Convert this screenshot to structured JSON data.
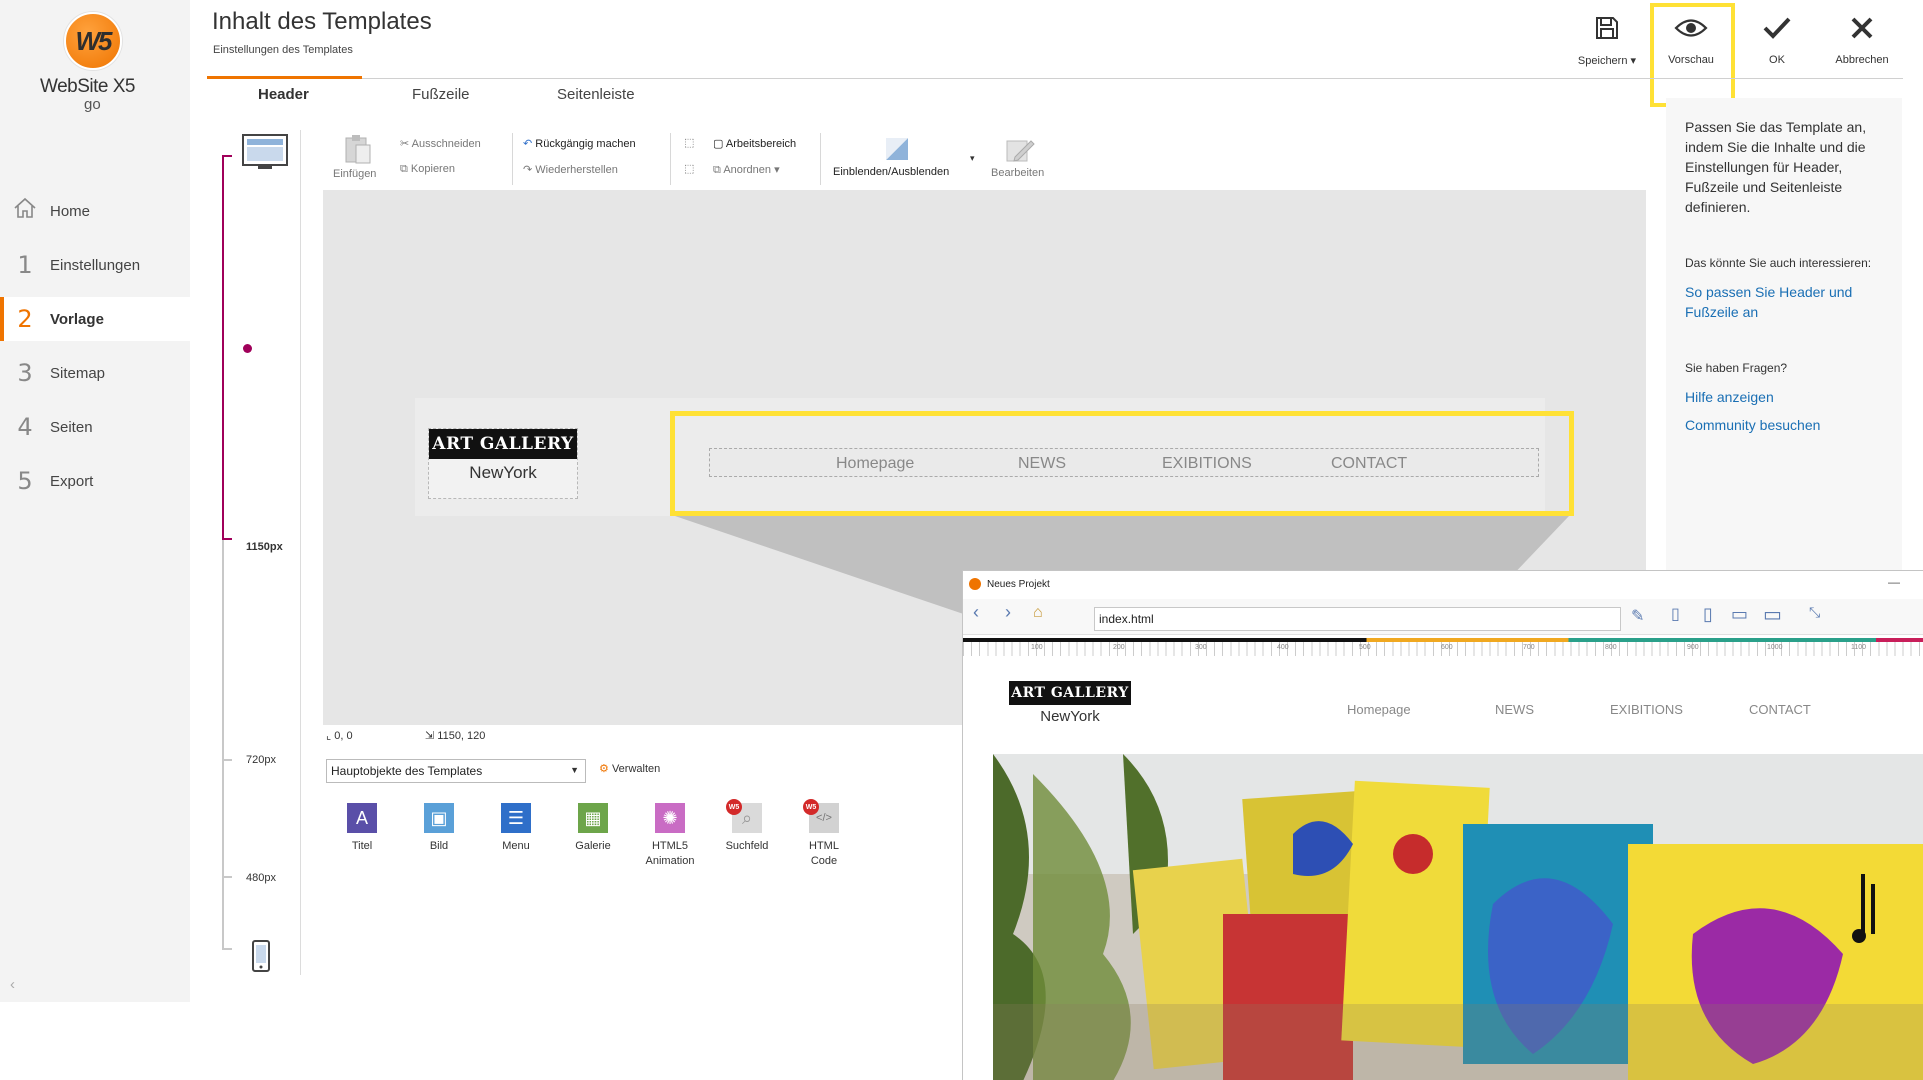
{
  "app": {
    "logo_mark": "W5",
    "logo_name": "WebSite X5",
    "logo_sub": "go"
  },
  "sidebar": {
    "items": [
      {
        "num": "",
        "label": "Home",
        "icon": "home-icon"
      },
      {
        "num": "1",
        "label": "Einstellungen"
      },
      {
        "num": "2",
        "label": "Vorlage",
        "active": true
      },
      {
        "num": "3",
        "label": "Sitemap"
      },
      {
        "num": "4",
        "label": "Seiten"
      },
      {
        "num": "5",
        "label": "Export"
      }
    ],
    "collapse": "‹"
  },
  "header": {
    "title": "Inhalt des Templates",
    "subtitle": "Einstellungen des Templates",
    "buttons": {
      "save": "Speichern",
      "preview": "Vorschau",
      "ok": "OK",
      "cancel": "Abbrechen"
    }
  },
  "tabs": [
    "Header",
    "Fußzeile",
    "Seitenleiste"
  ],
  "width_ruler": {
    "labels": [
      "1150px",
      "720px",
      "480px"
    ]
  },
  "edit_toolbar": {
    "paste": "Einfügen",
    "cut": "Ausschneiden",
    "copy": "Kopieren",
    "undo": "Rückgängig machen",
    "redo": "Wiederherstellen",
    "workspace": "Arbeitsbereich",
    "arrange": "Anordnen",
    "show_hide": "Einblenden/Ausblenden",
    "edit": "Bearbeiten"
  },
  "canvas": {
    "logo_line1": "ART GALLERY",
    "logo_line2": "NewYork",
    "menu": [
      "Homepage",
      "NEWS",
      "EXIBITIONS",
      "CONTACT"
    ],
    "pos": "0, 0",
    "size": "1150, 120"
  },
  "objects": {
    "category": "Hauptobjekte des Templates",
    "manage": "Verwalten",
    "items": [
      {
        "name": "Titel",
        "color": "#5a4fa8",
        "glyph": "A"
      },
      {
        "name": "Bild",
        "color": "#5aa0d8",
        "glyph": "▣"
      },
      {
        "name": "Menu",
        "color": "#2f6fc9",
        "glyph": "☰"
      },
      {
        "name": "Galerie",
        "color": "#6da54a",
        "glyph": "▦"
      },
      {
        "name": "HTML5 Animation",
        "color": "#c96cc4",
        "glyph": "✺"
      },
      {
        "name": "Suchfeld",
        "color": "#d8d8d8",
        "glyph": "⌕",
        "badge": "W5"
      },
      {
        "name": "HTML Code",
        "color": "#d0d0d0",
        "glyph": "</>",
        "badge": "W5"
      }
    ]
  },
  "help_panel": {
    "intro": "Passen Sie das Template an, indem Sie die Inhalte und die Einstellungen für Header, Fußzeile und Seitenleiste definieren.",
    "interest_head": "Das könnte Sie auch interessieren:",
    "interest_link": "So passen Sie Header und Fußzeile an",
    "questions_head": "Sie haben Fragen?",
    "help_link": "Hilfe anzeigen",
    "community_link": "Community besuchen"
  },
  "preview_window": {
    "title": "Neues Projekt",
    "url": "index.html",
    "ruler_labels": [
      "100",
      "200",
      "300",
      "400",
      "500",
      "600",
      "700",
      "800",
      "900",
      "1000",
      "1100"
    ],
    "logo_line1": "ART GALLERY",
    "logo_line2": "NewYork",
    "menu": [
      "Homepage",
      "NEWS",
      "EXIBITIONS",
      "CONTACT"
    ]
  },
  "colors": {
    "accent": "#ef7400",
    "ruler": "#a0005a",
    "highlight": "#ffe135",
    "link": "#1a6fb4"
  }
}
